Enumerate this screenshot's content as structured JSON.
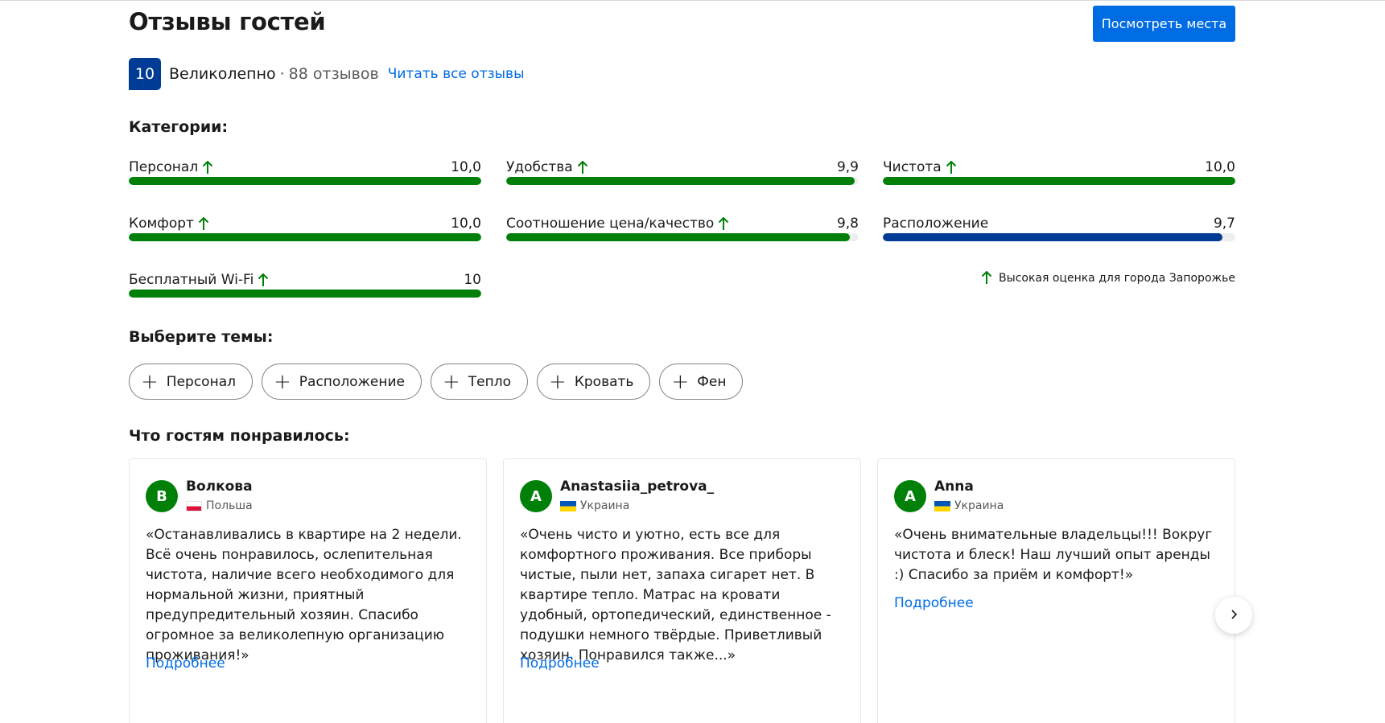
{
  "header": {
    "title": "Отзывы гостей",
    "cta_label": "Посмотреть места"
  },
  "score": {
    "value": "10",
    "word": "Великолепно",
    "separator": "·",
    "count": "88 отзывов",
    "read_all": "Читать все отзывы"
  },
  "categories_title": "Категории:",
  "categories": [
    {
      "label": "Персонал",
      "value": "10,0",
      "score": 10.0,
      "high": true
    },
    {
      "label": "Удобства",
      "value": "9,9",
      "score": 9.9,
      "high": true
    },
    {
      "label": "Чистота",
      "value": "10,0",
      "score": 10.0,
      "high": true
    },
    {
      "label": "Комфорт",
      "value": "10,0",
      "score": 10.0,
      "high": true
    },
    {
      "label": "Соотношение цена/качество",
      "value": "9,8",
      "score": 9.8,
      "high": true
    },
    {
      "label": "Расположение",
      "value": "9,7",
      "score": 9.7,
      "high": false
    },
    {
      "label": "Бесплатный Wi-Fi",
      "value": "10",
      "score": 10.0,
      "high": true
    }
  ],
  "high_note": "Высокая оценка для города Запорожье",
  "topics_title": "Выберите темы:",
  "topics": [
    "Персонал",
    "Расположение",
    "Тепло",
    "Кровать",
    "Фен"
  ],
  "liked_title": "Что гостям понравилось:",
  "reviews": [
    {
      "initial": "В",
      "name": "Волкова",
      "country": "Польша",
      "text": "«Останавливались в квартире на 2 недели. Всё очень понравилось, ослепительная чистота, наличие всего необходимого для нормальной жизни, приятный предупредительный хозяин. Спасибо огромное за великолепную организацию проживания!»",
      "more": "Подробнее"
    },
    {
      "initial": "A",
      "name": "Anastasiia_petrova_",
      "country": "Украина",
      "text": "«Очень чисто и уютно, есть все для комфортного проживания. Все приборы чистые, пыли нет, запаха сигарет нет. В квартире тепло. Матрас на кровати удобный, ортопедический, единственное - подушки немного твёрдые. Приветливый хозяин. Понравился также...»",
      "more": "Подробнее"
    },
    {
      "initial": "A",
      "name": "Anna",
      "country": "Украина",
      "text": "«Очень внимательные владельцы!!! Вокруг чистота и блеск! Наш лучший опыт аренды :) Спасибо за приём и комфорт!»",
      "more": "Подробнее"
    }
  ],
  "colors": {
    "brand_blue": "#006ce4",
    "dark_blue": "#003b95",
    "green": "#008009"
  },
  "icons": {
    "arrow": "arrow-up-icon",
    "plus": "plus-icon",
    "next": "chevron-right-icon"
  }
}
